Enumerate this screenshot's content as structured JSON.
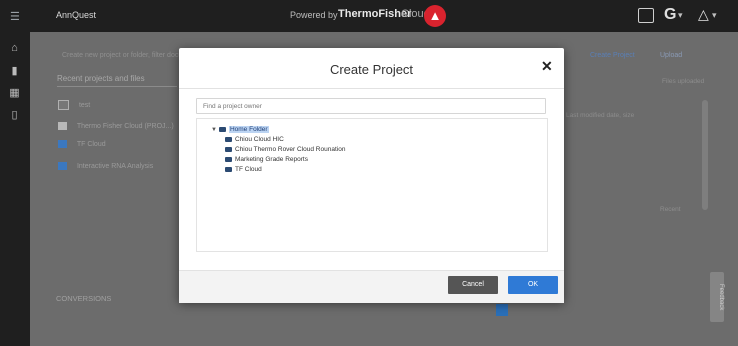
{
  "topbar": {
    "menu_icon": "hamburger-icon",
    "brand": "AnnQuest",
    "powered_by": "Powered by",
    "company": "ThermoFisher",
    "cloud": "Cloud",
    "logo_letter": "▲",
    "icons": [
      "chat-icon",
      "g-icon",
      "bell-icon"
    ],
    "dropdown_glyph": "▾"
  },
  "rail": {
    "icons": [
      "home-icon",
      "file-icon",
      "grid-icon",
      "document-icon"
    ]
  },
  "page": {
    "breadcrumb": "Create new project or folder, filter documents",
    "recent_tab": "Recent projects and files",
    "items": [
      "test",
      "Thermo Fisher Cloud (PROJ...)",
      "TF Cloud",
      "Interactive RNA Analysis"
    ],
    "right_link_primary": "Create Project",
    "right_link_secondary": "Upload",
    "right_small": "Files uploaded",
    "right_detail": "Last modified date, size",
    "right_note": "Recent",
    "bottom_title": "CONVERSIONS",
    "feedback": "Feedback"
  },
  "dialog": {
    "title": "Create Project",
    "close_glyph": "✕",
    "search_placeholder": "Find a project owner",
    "tree": {
      "root": "Home Folder",
      "children": [
        "Chiou Cloud HIC",
        "Chiou Thermo Rover Cloud Rounation",
        "Marketing Grade Reports",
        "TF Cloud"
      ]
    },
    "cancel_label": "Cancel",
    "ok_label": "OK"
  }
}
